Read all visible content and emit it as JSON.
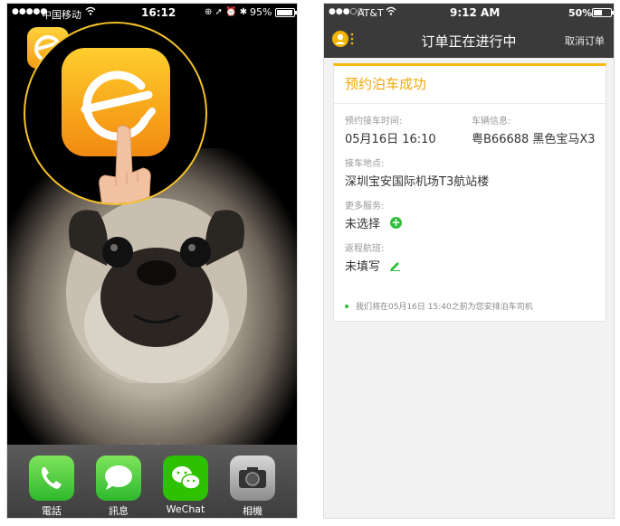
{
  "left_phone": {
    "status_bar": {
      "signal": "●●●●●",
      "carrier": "中国移动",
      "time": "16:12",
      "status_icons": "⊕ ➚ ⏰ ✱",
      "battery": "95%",
      "battery_level": 0.95
    },
    "dock": [
      {
        "label": "電話",
        "icon": "phone-icon"
      },
      {
        "label": "訊息",
        "icon": "messages-icon"
      },
      {
        "label": "WeChat",
        "icon": "wechat-icon"
      },
      {
        "label": "相機",
        "icon": "camera-icon"
      }
    ],
    "page_indicator": {
      "pages": 3,
      "current": 3
    }
  },
  "right_phone": {
    "status_bar": {
      "signal": "●●●○○",
      "carrier": "AT&T",
      "time": "9:12 AM",
      "battery": "50%",
      "battery_level": 0.5
    },
    "nav": {
      "title": "订单正在进行中",
      "cancel": "取消订单"
    },
    "card": {
      "title": "预约泊车成功",
      "pickup_time_label": "预约接车时间:",
      "pickup_time": "05月16日 16:10",
      "vehicle_label": "车辆信息:",
      "vehicle": "粤B66688 黑色宝马X3",
      "location_label": "接车地点:",
      "location": "深圳宝安国际机场T3航站楼",
      "services_label": "更多服务:",
      "services": "未选择",
      "return_flight_label": "返程航班:",
      "return_flight": "未填写",
      "note": "我们将在05月16日 15:40之前为您安排泊车司机"
    },
    "colors": {
      "accent": "#f5b80c",
      "green": "#2dbe3c",
      "nav": "#3a3a3a"
    }
  }
}
